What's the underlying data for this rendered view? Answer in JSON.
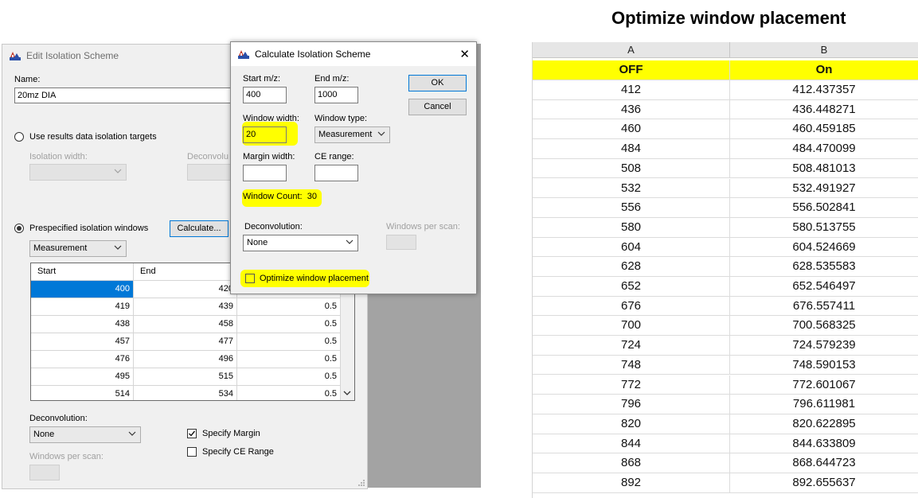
{
  "edit_window": {
    "title": "Edit Isolation Scheme",
    "name_label": "Name:",
    "name_value": "20mz DIA",
    "use_results_label": "Use results data isolation targets",
    "isolation_width_label": "Isolation width:",
    "deconvolution_label_truncated": "Deconvolu",
    "prespecified_label": "Prespecified isolation windows",
    "calculate_button": "Calculate...",
    "window_type_value": "Measurement",
    "grid": {
      "headers": [
        "Start",
        "End",
        ""
      ],
      "rows": [
        [
          "400",
          "420",
          ""
        ],
        [
          "419",
          "439",
          "0.5"
        ],
        [
          "438",
          "458",
          "0.5"
        ],
        [
          "457",
          "477",
          "0.5"
        ],
        [
          "476",
          "496",
          "0.5"
        ],
        [
          "495",
          "515",
          "0.5"
        ],
        [
          "514",
          "534",
          "0.5"
        ]
      ]
    },
    "deconvolution_label": "Deconvolution:",
    "deconvolution_value": "None",
    "specify_margin_label": "Specify Margin",
    "specify_margin_checked": true,
    "specify_ce_label": "Specify CE Range",
    "specify_ce_checked": false,
    "windows_per_scan_label": "Windows per scan:"
  },
  "calc_dialog": {
    "title": "Calculate Isolation Scheme",
    "close_glyph": "✕",
    "start_mz_label": "Start m/z:",
    "start_mz_value": "400",
    "end_mz_label": "End m/z:",
    "end_mz_value": "1000",
    "ok_button": "OK",
    "cancel_button": "Cancel",
    "window_width_label": "Window width:",
    "window_width_value": "20",
    "window_type_label": "Window type:",
    "window_type_value": "Measurement",
    "margin_width_label": "Margin width:",
    "ce_range_label": "CE range:",
    "window_count_label": "Window Count:",
    "window_count_value": "30",
    "deconvolution_label": "Deconvolution:",
    "deconvolution_value": "None",
    "windows_per_scan_label": "Windows per scan:",
    "optimize_label": "Optimize window placement",
    "optimize_checked": false,
    "highlight_color": "#ffff00"
  },
  "spreadsheet": {
    "title": "Optimize window placement",
    "columns": [
      "A",
      "B"
    ],
    "header_row": [
      "OFF",
      "On"
    ],
    "header_color": "#ffff00",
    "rows": [
      [
        "412",
        "412.437357"
      ],
      [
        "436",
        "436.448271"
      ],
      [
        "460",
        "460.459185"
      ],
      [
        "484",
        "484.470099"
      ],
      [
        "508",
        "508.481013"
      ],
      [
        "532",
        "532.491927"
      ],
      [
        "556",
        "556.502841"
      ],
      [
        "580",
        "580.513755"
      ],
      [
        "604",
        "604.524669"
      ],
      [
        "628",
        "628.535583"
      ],
      [
        "652",
        "652.546497"
      ],
      [
        "676",
        "676.557411"
      ],
      [
        "700",
        "700.568325"
      ],
      [
        "724",
        "724.579239"
      ],
      [
        "748",
        "748.590153"
      ],
      [
        "772",
        "772.601067"
      ],
      [
        "796",
        "796.611981"
      ],
      [
        "820",
        "820.622895"
      ],
      [
        "844",
        "844.633809"
      ],
      [
        "868",
        "868.644723"
      ],
      [
        "892",
        "892.655637"
      ]
    ]
  }
}
